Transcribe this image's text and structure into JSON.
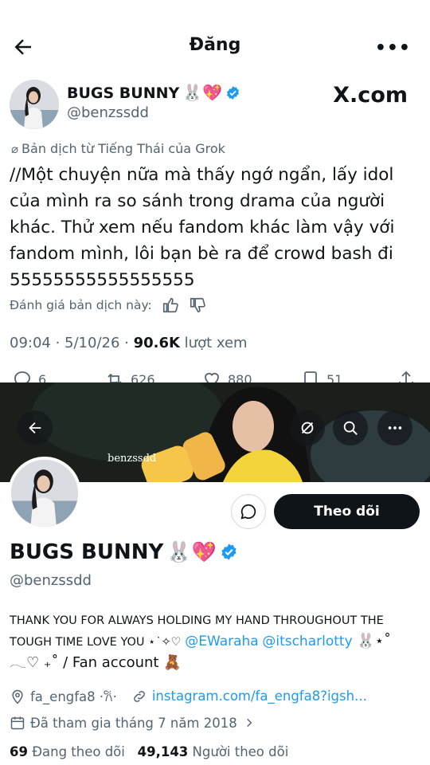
{
  "post_header": {
    "title": "Đăng",
    "more": "•••"
  },
  "post": {
    "author_name": "BUGS BUNNY",
    "author_emojis": "🐰💖",
    "author_handle": "@benzssdd",
    "watermark": "X.com",
    "translation_note": "Bản dịch từ Tiếng Thái của Grok",
    "body": "//Một chuyện nữa mà thấy ngớ ngẩn, lấy idol của mình ra so sánh trong drama của người khác. Thử xem nếu fandom khác làm vậy với fandom mình, lôi bạn bè ra để crowd bash đi 55555555555555555",
    "rate_label": "Đánh giá bản dịch này:",
    "time": "09:04 · 5/10/26 · ",
    "views_count": "90.6K",
    "views_label": " lượt xem",
    "stats": {
      "replies": "6",
      "reposts": "626",
      "likes": "880",
      "bookmarks": "51"
    }
  },
  "profile": {
    "banner_text": "benzssdd",
    "follow_label": "Theo dõi",
    "name": "BUGS BUNNY",
    "name_emojis": "🐰💖",
    "handle": "@benzssdd",
    "bio_line1": "THANK YOU FOR ALWAYS HOLDING MY HAND THROUGHOUT THE",
    "bio_line2_start": "TOUGH TIME LOVE YOU ⋆˙✧♡ ",
    "mention1": "@EWaraha",
    "mention2": "@itscharlotty",
    "bio_line2_end": " 🐰⋆˚",
    "bio_line3": "𓂃♡ ₊˚ / Fan account 🧸",
    "location": "fa_engfa8 ·𐙚·",
    "website": "instagram.com/fa_engfa8?igsh...",
    "joined": "Đã tham gia tháng 7 năm 2018",
    "following_count": "69",
    "following_label": " Đang theo dõi",
    "followers_count": "49,143",
    "followers_label": " Người theo dõi"
  },
  "colors": {
    "text": "#0f1419",
    "secondary": "#536471",
    "link": "#1d9bf0",
    "verified": "#1d9bf0"
  }
}
